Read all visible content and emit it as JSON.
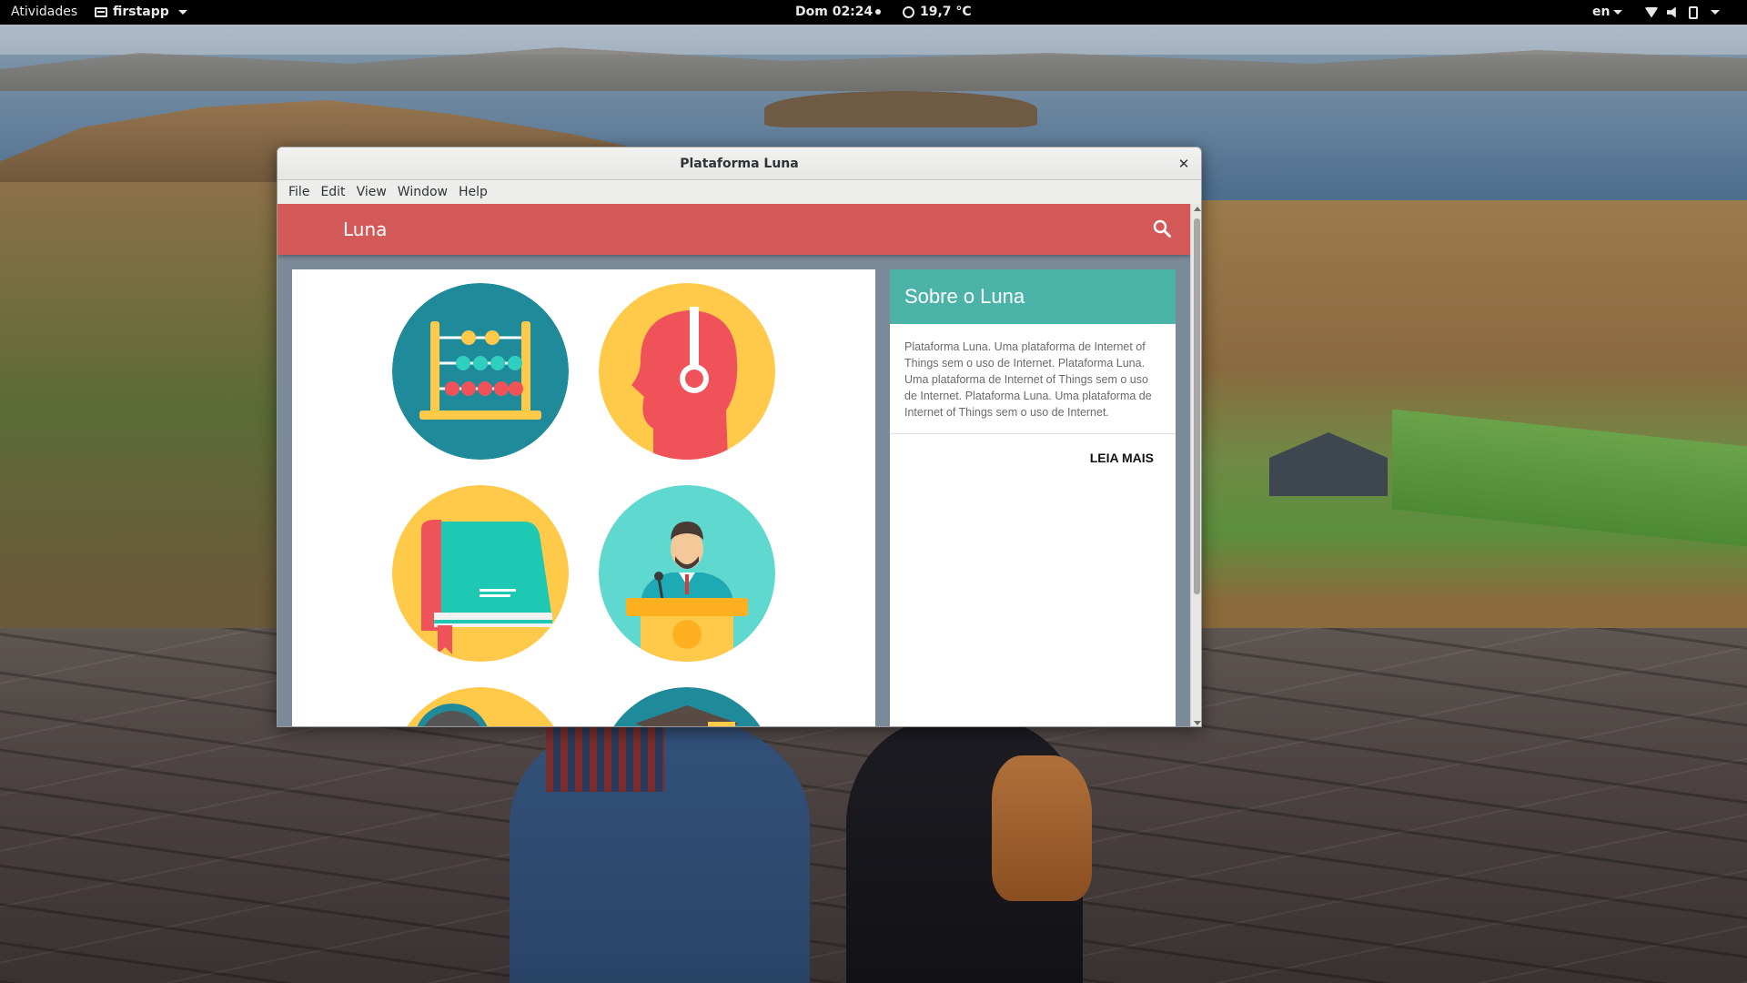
{
  "topbar": {
    "activities": "Atividades",
    "app_name": "firstapp",
    "clock": "Dom 02:24",
    "weather": "19,7 °C",
    "language": "en",
    "status_icons": [
      "wifi-icon",
      "volume-icon",
      "power-icon"
    ]
  },
  "window": {
    "title": "Plataforma Luna",
    "close_glyph": "✕",
    "menu": [
      "File",
      "Edit",
      "View",
      "Window",
      "Help"
    ]
  },
  "app": {
    "header_title": "Luna",
    "header_color": "#d45a5a",
    "tiles": [
      {
        "icon": "abacus-icon",
        "bg": "#1f8a9a"
      },
      {
        "icon": "headphones-head-icon",
        "bg": "#ffc94a"
      },
      {
        "icon": "book-icon",
        "bg": "#ffc94a"
      },
      {
        "icon": "speaker-podium-icon",
        "bg": "#5fd8d0"
      },
      {
        "icon": "partial-tile-icon",
        "bg": "#ffc94a"
      },
      {
        "icon": "graduation-cap-icon",
        "bg": "#1f8a9a"
      }
    ],
    "sidebar": {
      "title": "Sobre o Luna",
      "title_bg": "#4cb3a9",
      "body": "Plataforma Luna. Uma plataforma de Internet of Things sem o uso de Internet. Plataforma Luna. Uma plataforma de Internet of Things sem o uso de Internet. Plataforma Luna. Uma plataforma de Internet of Things sem o uso de Internet.",
      "action": "LEIA MAIS"
    }
  }
}
